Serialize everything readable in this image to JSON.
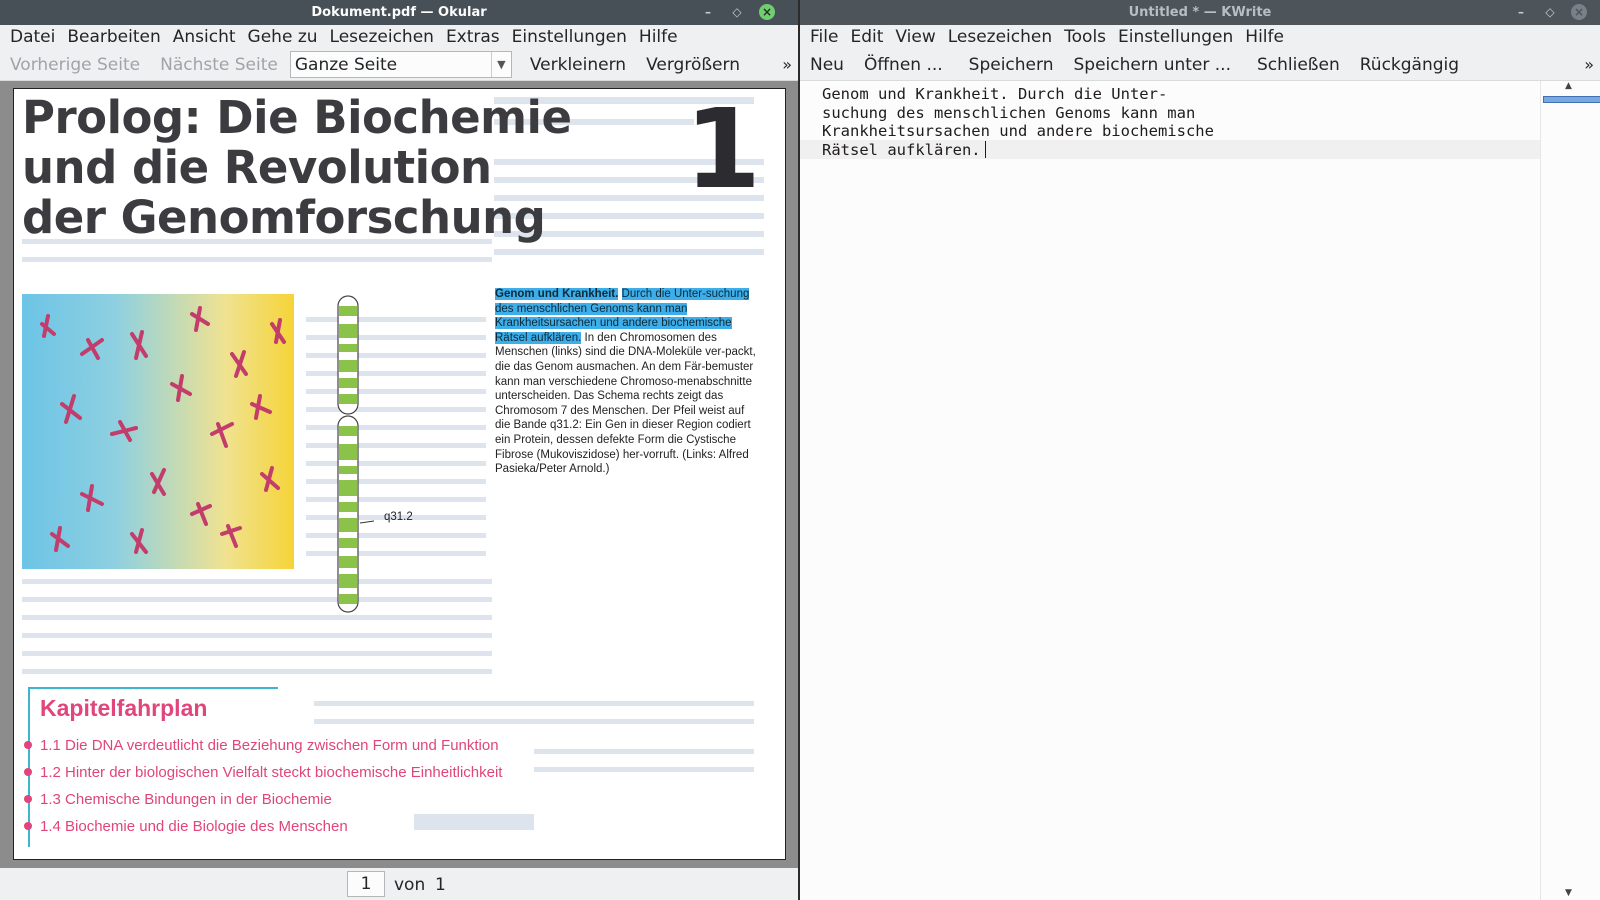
{
  "okular": {
    "title": "Dokument.pdf — Okular",
    "menu": [
      "Datei",
      "Bearbeiten",
      "Ansicht",
      "Gehe zu",
      "Lesezeichen",
      "Extras",
      "Einstellungen",
      "Hilfe"
    ],
    "toolbar": {
      "prev_page": "Vorherige Seite",
      "next_page": "Nächste Seite",
      "zoom_mode": "Ganze Seite",
      "zoom_out": "Verkleinern",
      "zoom_in": "Vergrößern",
      "more": "»"
    },
    "document": {
      "title_lines": [
        "Prolog: Die Biochemie",
        "und die Revolution",
        "der Genomforschung"
      ],
      "chapter_number": "1",
      "caption_selected_bold": "Genom und Krankheit.",
      "caption_selected_rest": "Durch die Unter-suchung des menschlichen Genoms kann man Krankheitsursachen und andere biochemische Rätsel aufklären.",
      "caption_rest": "In den Chromosomen des Menschen (links) sind die DNA-Moleküle ver-packt, die das Genom ausmachen. An dem Fär-bemuster kann man verschiedene Chromoso-menabschnitte unterscheiden. Das Schema rechts zeigt das Chromosom 7 des Menschen. Der Pfeil weist auf die Bande q31.2: Ein Gen in dieser Region codiert ein Protein, dessen defekte Form die Cystische Fibrose (Mukoviszidose) her-vorruft. (Links: Alfred Pasieka/Peter Arnold.)",
      "chromosome_label": "q31.2",
      "roadmap_title": "Kapitelfahrplan",
      "roadmap_items": [
        "1.1  Die DNA verdeutlicht die Beziehung zwischen Form und Funktion",
        "1.2  Hinter der biologischen Vielfalt steckt biochemische Einheitlichkeit",
        "1.3  Chemische Bindungen in der Biochemie",
        "1.4  Biochemie und die Biologie des Menschen"
      ]
    },
    "pagebar": {
      "current": "1",
      "of_label": "von",
      "total": "1"
    }
  },
  "kwrite": {
    "title": "Untitled * — KWrite",
    "menu": [
      "File",
      "Edit",
      "View",
      "Lesezeichen",
      "Tools",
      "Einstellungen",
      "Hilfe"
    ],
    "toolbar": {
      "new": "Neu",
      "open": "Öffnen ...",
      "save": "Speichern",
      "save_as": "Speichern unter ...",
      "close": "Schließen",
      "undo": "Rückgängig",
      "more": "»"
    },
    "text_lines": [
      "Genom und Krankheit. Durch die Unter-",
      "suchung des menschlichen Genoms kann man",
      "Krankheitsursachen und andere biochemische",
      "Rätsel aufklären."
    ]
  },
  "colors": {
    "selection": "#3daee9",
    "accent_pink": "#e0457b",
    "titlebar": "#475057"
  }
}
